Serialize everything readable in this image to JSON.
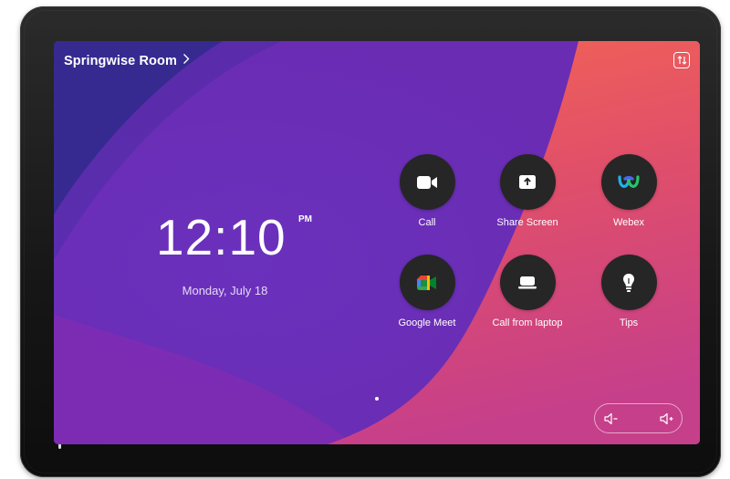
{
  "room": {
    "name": "Springwise Room"
  },
  "clock": {
    "time": "12:10",
    "period": "PM",
    "date": "Monday, July 18"
  },
  "apps": [
    {
      "label": "Call",
      "icon": "video-camera-icon"
    },
    {
      "label": "Share Screen",
      "icon": "share-screen-icon"
    },
    {
      "label": "Webex",
      "icon": "webex-logo-icon"
    },
    {
      "label": "Google Meet",
      "icon": "google-meet-logo-icon"
    },
    {
      "label": "Call from laptop",
      "icon": "laptop-icon"
    },
    {
      "label": "Tips",
      "icon": "lightbulb-icon"
    }
  ],
  "colors": {
    "bezel": "#161616",
    "button_bg": "#262626",
    "wallpaper_left": "#5c2aa8",
    "wallpaper_right": "#f0605a"
  }
}
